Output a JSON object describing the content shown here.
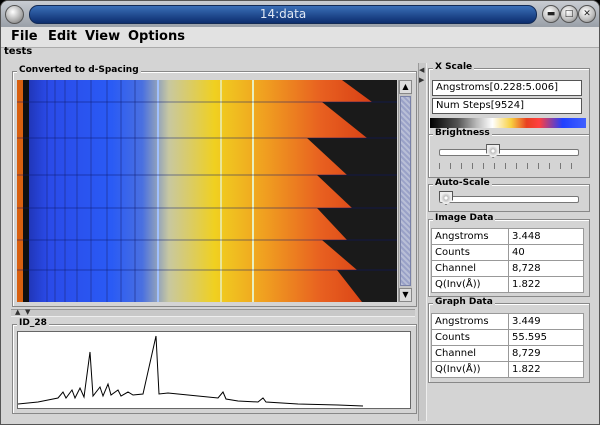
{
  "window": {
    "title": "14:data"
  },
  "menubar": {
    "items": [
      "File",
      "Edit",
      "View",
      "Options"
    ]
  },
  "panel": {
    "title": "tests"
  },
  "image_panel": {
    "title": "Converted to d-Spacing"
  },
  "graph_panel": {
    "title": "ID_28"
  },
  "xscale": {
    "title": "X Scale",
    "range_value": "Angstroms[0.228:5.006]",
    "steps_value": "Num Steps[9524]"
  },
  "brightness": {
    "title": "Brightness",
    "level": 0.38
  },
  "autoscale": {
    "title": "Auto-Scale",
    "level": 0.0
  },
  "image_data": {
    "title": "Image Data",
    "rows": [
      {
        "label": "Angstroms",
        "value": "3.448"
      },
      {
        "label": "Counts",
        "value": "40"
      },
      {
        "label": "Channel",
        "value": "8,728"
      },
      {
        "label": "Q(Inv(Å))",
        "value": "1.822"
      }
    ]
  },
  "graph_data": {
    "title": "Graph Data",
    "rows": [
      {
        "label": "Angstroms",
        "value": "3.449"
      },
      {
        "label": "Counts",
        "value": "55.595"
      },
      {
        "label": "Channel",
        "value": "8,729"
      },
      {
        "label": "Q(Inv(Å))",
        "value": "1.822"
      }
    ]
  },
  "colors": {
    "title_bar": "#1a3f85",
    "accent": "#2a5bf5",
    "hot": "#f0d020"
  }
}
